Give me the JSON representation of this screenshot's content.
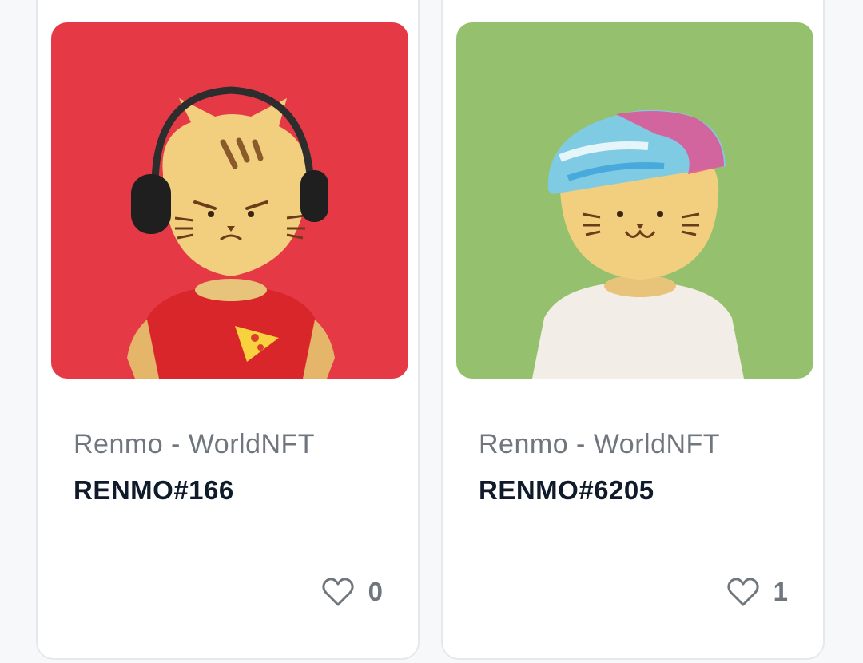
{
  "cards": [
    {
      "collection": "Renmo - WorldNFT",
      "token": "RENMO#166",
      "likes": "0",
      "background": "#e63946",
      "image": "cat-with-headphones-and-pizza-shirt"
    },
    {
      "collection": "Renmo - WorldNFT",
      "token": "RENMO#6205",
      "likes": "1",
      "background": "#95c06e",
      "image": "cat-with-tie-dye-helmet-and-white-sweater"
    }
  ],
  "colors": {
    "card_border": "#e6e8ec",
    "collection_text": "#6f767e",
    "token_text": "#0f1a2a",
    "heart_stroke": "#6f767e"
  }
}
